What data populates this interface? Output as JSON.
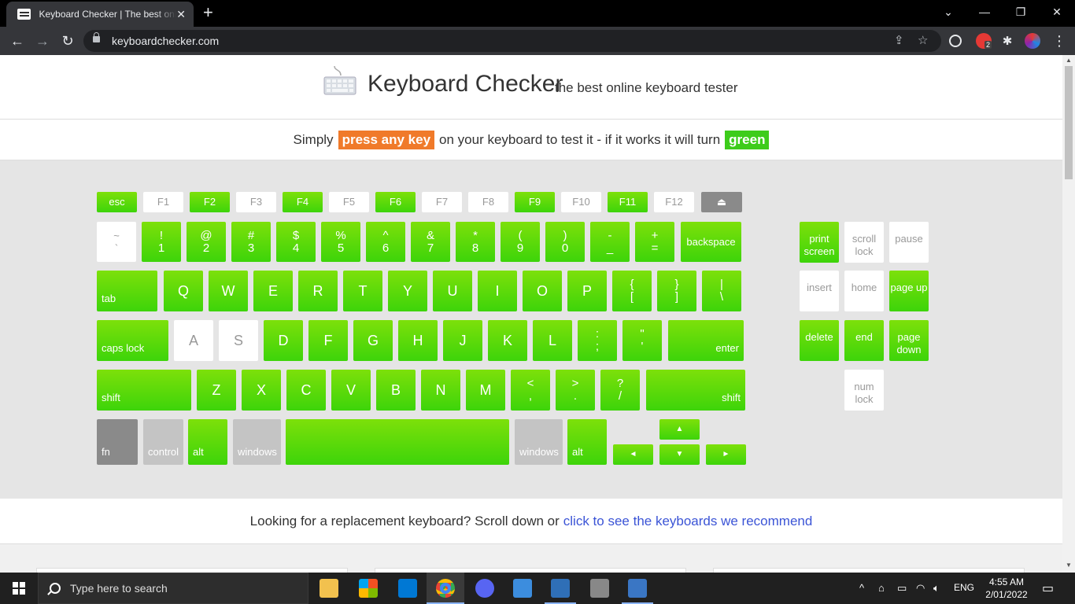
{
  "browser": {
    "tab_title": "Keyboard Checker | The best online keyboard tester",
    "url": "keyboardchecker.com",
    "extension_badge": "2"
  },
  "header": {
    "title": "Keyboard Checker",
    "subtitle": "the best online keyboard tester"
  },
  "instructions": {
    "prefix": "Simply",
    "press_badge": "press any key",
    "middle": "on your keyboard to test it - if it works it will turn",
    "green_badge": "green"
  },
  "keyboard": {
    "row_fn": [
      {
        "label": "esc",
        "on": true
      },
      {
        "label": "F1",
        "on": false
      },
      {
        "label": "F2",
        "on": true
      },
      {
        "label": "F3",
        "on": false
      },
      {
        "label": "F4",
        "on": true
      },
      {
        "label": "F5",
        "on": false
      },
      {
        "label": "F6",
        "on": true
      },
      {
        "label": "F7",
        "on": false
      },
      {
        "label": "F8",
        "on": false
      },
      {
        "label": "F9",
        "on": true
      },
      {
        "label": "F10",
        "on": false
      },
      {
        "label": "F11",
        "on": true
      },
      {
        "label": "F12",
        "on": false
      },
      {
        "label": "⏏",
        "on": false
      }
    ],
    "row_num": [
      {
        "top": "~",
        "bottom": "`",
        "on": false
      },
      {
        "top": "!",
        "bottom": "1",
        "on": true
      },
      {
        "top": "@",
        "bottom": "2",
        "on": true
      },
      {
        "top": "#",
        "bottom": "3",
        "on": true
      },
      {
        "top": "$",
        "bottom": "4",
        "on": true
      },
      {
        "top": "%",
        "bottom": "5",
        "on": true
      },
      {
        "top": "^",
        "bottom": "6",
        "on": true
      },
      {
        "top": "&",
        "bottom": "7",
        "on": true
      },
      {
        "top": "*",
        "bottom": "8",
        "on": true
      },
      {
        "top": "(",
        "bottom": "9",
        "on": true
      },
      {
        "top": ")",
        "bottom": "0",
        "on": true
      },
      {
        "top": "-",
        "bottom": "_",
        "on": true
      },
      {
        "top": "+",
        "bottom": "=",
        "on": true
      },
      {
        "label": "backspace",
        "on": true
      }
    ],
    "row_tab": [
      {
        "label": "tab",
        "on": true
      },
      {
        "label": "Q",
        "on": true
      },
      {
        "label": "W",
        "on": true
      },
      {
        "label": "E",
        "on": true
      },
      {
        "label": "R",
        "on": true
      },
      {
        "label": "T",
        "on": true
      },
      {
        "label": "Y",
        "on": true
      },
      {
        "label": "U",
        "on": true
      },
      {
        "label": "I",
        "on": true
      },
      {
        "label": "O",
        "on": true
      },
      {
        "label": "P",
        "on": true
      },
      {
        "top": "{",
        "bottom": "[",
        "on": true
      },
      {
        "top": "}",
        "bottom": "]",
        "on": true
      },
      {
        "top": "|",
        "bottom": "\\",
        "on": true
      }
    ],
    "row_caps": [
      {
        "label": "caps lock",
        "on": true
      },
      {
        "label": "A",
        "on": false
      },
      {
        "label": "S",
        "on": false
      },
      {
        "label": "D",
        "on": true
      },
      {
        "label": "F",
        "on": true
      },
      {
        "label": "G",
        "on": true
      },
      {
        "label": "H",
        "on": true
      },
      {
        "label": "J",
        "on": true
      },
      {
        "label": "K",
        "on": true
      },
      {
        "label": "L",
        "on": true
      },
      {
        "top": ":",
        "bottom": ";",
        "on": true
      },
      {
        "top": "\"",
        "bottom": "'",
        "on": true
      },
      {
        "label": "enter",
        "on": true
      }
    ],
    "row_shift": [
      {
        "label": "shift",
        "on": true
      },
      {
        "label": "Z",
        "on": true
      },
      {
        "label": "X",
        "on": true
      },
      {
        "label": "C",
        "on": true
      },
      {
        "label": "V",
        "on": true
      },
      {
        "label": "B",
        "on": true
      },
      {
        "label": "N",
        "on": true
      },
      {
        "label": "M",
        "on": true
      },
      {
        "top": "<",
        "bottom": ",",
        "on": true
      },
      {
        "top": ">",
        "bottom": ".",
        "on": true
      },
      {
        "top": "?",
        "bottom": "/",
        "on": true
      },
      {
        "label": "shift",
        "on": true
      }
    ],
    "row_bottom": [
      {
        "label": "fn",
        "state": "dark"
      },
      {
        "label": "control",
        "state": "gray"
      },
      {
        "label": "alt",
        "state": "on"
      },
      {
        "label": "windows",
        "state": "gray"
      },
      {
        "label": "",
        "state": "on"
      },
      {
        "label": "windows",
        "state": "gray"
      },
      {
        "label": "alt",
        "state": "on"
      }
    ],
    "arrows": {
      "up": "▲",
      "left": "◄",
      "down": "▼",
      "right": "►"
    },
    "nav_cluster": [
      {
        "label": "print screen",
        "on": true
      },
      {
        "label": "scroll lock",
        "on": false
      },
      {
        "label": "pause",
        "on": false
      },
      {
        "label": "insert",
        "on": false
      },
      {
        "label": "home",
        "on": false
      },
      {
        "label": "page up",
        "on": true
      },
      {
        "label": "delete",
        "on": true
      },
      {
        "label": "end",
        "on": true
      },
      {
        "label": "page down",
        "on": true
      },
      {
        "label": "num lock",
        "on": false
      }
    ]
  },
  "recommend": {
    "text": "Looking for a replacement keyboard? Scroll down or",
    "link": "click to see the keyboards we recommend"
  },
  "taskbar": {
    "search_placeholder": "Type here to search",
    "language": "ENG",
    "time": "4:55 AM",
    "date": "2/01/2022"
  }
}
